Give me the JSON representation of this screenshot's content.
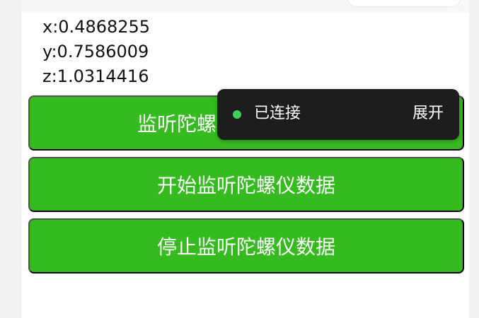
{
  "readouts": {
    "x": "x:0.4868255",
    "y": "y:0.7586009",
    "z": "z:1.0314416"
  },
  "buttons": {
    "gyro_change_events": "监听陀螺仪数据变化事件",
    "start_gyro": "开始监听陀螺仪数据",
    "stop_gyro": "停止监听陀螺仪数据"
  },
  "toast": {
    "status": "已连接",
    "expand": "展开"
  },
  "colors": {
    "primary_green": "#35bb1f",
    "toast_bg": "#1d1d1d",
    "status_dot": "#3fcf5a"
  }
}
